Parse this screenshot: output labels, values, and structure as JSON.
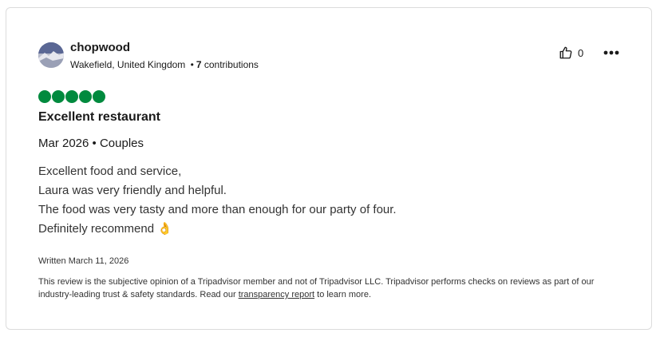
{
  "reviewer": {
    "username": "chopwood",
    "location": "Wakefield, United Kingdom",
    "separator": "•",
    "contributions_count": "7",
    "contributions_label": "contributions"
  },
  "actions": {
    "helpful_count": "0"
  },
  "review": {
    "rating": 5,
    "rating_color": "#008a3e",
    "title": "Excellent restaurant",
    "trip_info": "Mar 2026 • Couples",
    "body_lines": [
      "Excellent food and service,",
      "Laura was very friendly and helpful.",
      "The food was very tasty and more than enough for our party of four.",
      "Definitely recommend 👌"
    ],
    "written_date": "Written March 11, 2026"
  },
  "disclaimer": {
    "text_before": "This review is the subjective opinion of a Tripadvisor member and not of Tripadvisor LLC. Tripadvisor performs checks on reviews as part of our industry-leading trust & safety standards. Read our ",
    "link_text": "transparency report",
    "text_after": " to learn more."
  },
  "icons": {
    "helpful": "thumbs-up-icon",
    "more": "ellipsis-icon",
    "avatar": "user-avatar-photo"
  }
}
